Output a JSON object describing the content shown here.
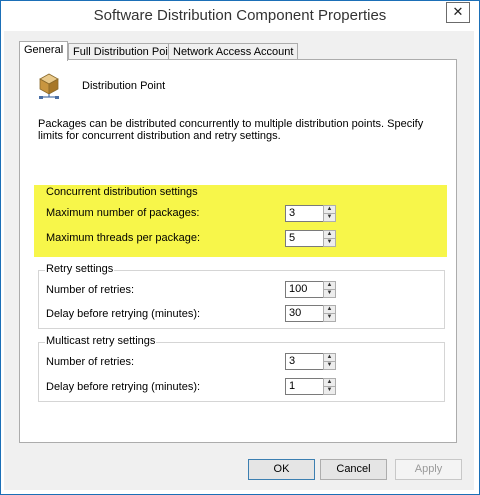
{
  "window": {
    "title": "Software Distribution Component Properties",
    "close_glyph": "✕"
  },
  "tabs": [
    {
      "label": "General",
      "active": true
    },
    {
      "label": "Full Distribution Point",
      "active": false
    },
    {
      "label": "Network Access Account",
      "active": false
    }
  ],
  "header": {
    "label": "Distribution Point",
    "icon": "distribution-point-icon"
  },
  "description": "Packages can be distributed concurrently to multiple distribution points. Specify limits for concurrent distribution and retry settings.",
  "concurrent": {
    "title": "Concurrent distribution settings",
    "max_packages_label": "Maximum number of packages:",
    "max_packages_value": "3",
    "max_threads_label": "Maximum threads per package:",
    "max_threads_value": "5",
    "highlight_color": "#f6f52a"
  },
  "retry": {
    "title": "Retry settings",
    "retries_label": "Number of retries:",
    "retries_value": "100",
    "delay_label": "Delay before retrying (minutes):",
    "delay_value": "30"
  },
  "multicast": {
    "title": "Multicast retry settings",
    "retries_label": "Number of retries:",
    "retries_value": "3",
    "delay_label": "Delay before retrying (minutes):",
    "delay_value": "1"
  },
  "buttons": {
    "ok": "OK",
    "cancel": "Cancel",
    "apply": "Apply"
  }
}
